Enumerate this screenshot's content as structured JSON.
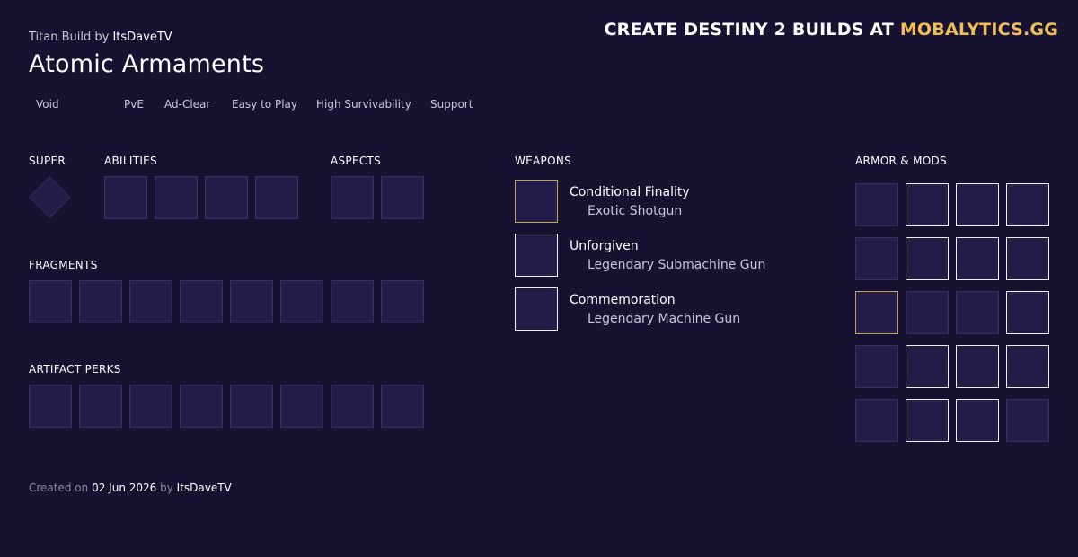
{
  "build": {
    "class_prefix": "Titan Build",
    "by_word": "by",
    "author": "ItsDaveTV",
    "title": "Atomic Armaments",
    "tags": [
      "Void",
      "PvE",
      "Ad-Clear",
      "Easy to Play",
      "High Survivability",
      "Support"
    ]
  },
  "promo": {
    "text": "CREATE DESTINY 2 BUILDS AT",
    "brand": "MOBALYTICS.GG",
    "brand_color": "#f0be58"
  },
  "sections": {
    "super": "SUPER",
    "abilities": "ABILITIES",
    "aspects": "ASPECTS",
    "fragments": "FRAGMENTS",
    "artifact_perks": "ARTIFACT PERKS",
    "weapons": "WEAPONS",
    "armor_mods": "ARMOR & MODS"
  },
  "weapons": [
    {
      "name": "Conditional Finality",
      "type": "Exotic Shotgun",
      "rarity": "exotic"
    },
    {
      "name": "Unforgiven",
      "type": "Legendary Submachine Gun",
      "rarity": "legendary"
    },
    {
      "name": "Commemoration",
      "type": "Legendary Machine Gun",
      "rarity": "legendary"
    }
  ],
  "footer": {
    "created_on": "Created on",
    "date": "02 Jun 2026",
    "by_word": "by",
    "author": "ItsDaveTV"
  },
  "colors": {
    "background": "#171232",
    "slot_fill": "#241d4a",
    "exotic_border": "#c9a14d",
    "equipped_border": "#f2f0fa"
  }
}
